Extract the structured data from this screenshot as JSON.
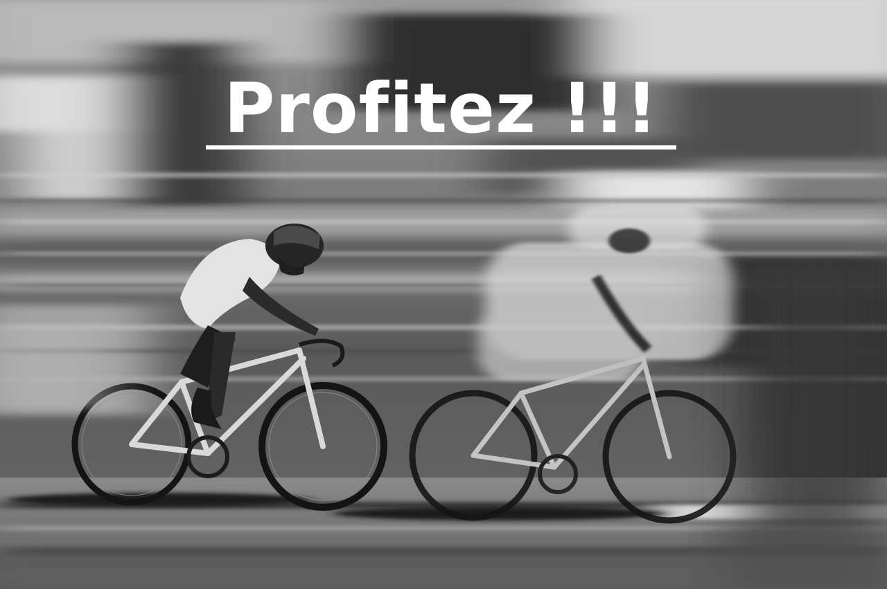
{
  "headline": {
    "text": "Profitez !!!",
    "color": "#ffffff",
    "underline": true
  },
  "photo": {
    "style": "black-and-white",
    "colors": {
      "sky": "#cfcfcf",
      "background_mid": "#8a8a8a",
      "background_dark": "#3f3f3f",
      "road": "#777777",
      "road_light": "#b5b5b5",
      "shadow": "#1e1e1e",
      "jersey": "#e6e6e6",
      "skin": "#2a2a2a",
      "bike_frame": "#d9d9d9",
      "tire": "#141414"
    }
  }
}
